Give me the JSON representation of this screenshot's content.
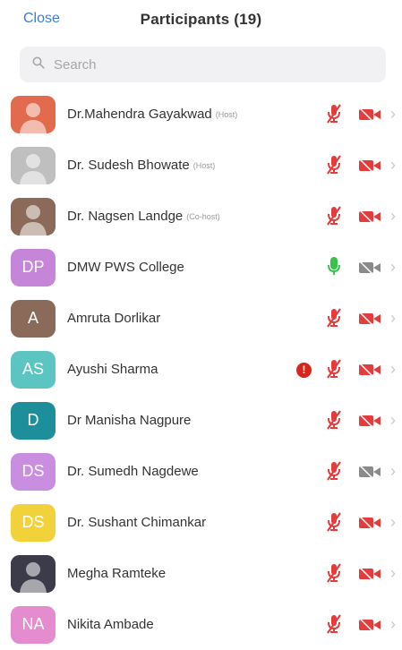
{
  "header": {
    "close_label": "Close",
    "title": "Participants (19)"
  },
  "search": {
    "placeholder": "Search"
  },
  "colors": {
    "accent": "#3a7dd8",
    "muted_red": "#e43b3b",
    "mic_on_green": "#37c24b",
    "video_off_gray": "#8a8a8a",
    "alert_red": "#d9261c"
  },
  "participants": [
    {
      "name": "Dr.Mahendra Gayakwad",
      "role": "(Host)",
      "avatar_type": "photo",
      "initials": "",
      "avatar_color": "#e26b4d",
      "mic": "muted",
      "video": "off-red",
      "alert": false
    },
    {
      "name": "Dr. Sudesh Bhowate",
      "role": "(Host)",
      "avatar_type": "photo",
      "initials": "",
      "avatar_color": "#bfbfbf",
      "mic": "muted",
      "video": "off-red",
      "alert": false
    },
    {
      "name": "Dr. Nagsen Landge",
      "role": "(Co-host)",
      "avatar_type": "photo",
      "initials": "",
      "avatar_color": "#8c6a5a",
      "mic": "muted",
      "video": "off-red",
      "alert": false
    },
    {
      "name": "DMW PWS College",
      "role": "",
      "avatar_type": "initials",
      "initials": "DP",
      "avatar_color": "#c586d9",
      "mic": "on",
      "video": "off-gray",
      "alert": false
    },
    {
      "name": "Amruta Dorlikar",
      "role": "",
      "avatar_type": "initials",
      "initials": "A",
      "avatar_color": "#8a6a58",
      "mic": "muted",
      "video": "off-red",
      "alert": false
    },
    {
      "name": "Ayushi Sharma",
      "role": "",
      "avatar_type": "initials",
      "initials": "AS",
      "avatar_color": "#5cc5c2",
      "mic": "muted",
      "video": "off-red",
      "alert": true
    },
    {
      "name": "Dr Manisha Nagpure",
      "role": "",
      "avatar_type": "initials",
      "initials": "D",
      "avatar_color": "#1c8f9a",
      "mic": "muted",
      "video": "off-red",
      "alert": false
    },
    {
      "name": "Dr. Sumedh Nagdewe",
      "role": "",
      "avatar_type": "initials",
      "initials": "DS",
      "avatar_color": "#c98ee0",
      "mic": "muted",
      "video": "off-gray",
      "alert": false
    },
    {
      "name": "Dr. Sushant Chimankar",
      "role": "",
      "avatar_type": "initials",
      "initials": "DS",
      "avatar_color": "#f2d23b",
      "mic": "muted",
      "video": "off-red",
      "alert": false
    },
    {
      "name": "Megha Ramteke",
      "role": "",
      "avatar_type": "photo",
      "initials": "",
      "avatar_color": "#3b3b4a",
      "mic": "muted",
      "video": "off-red",
      "alert": false
    },
    {
      "name": "Nikita Ambade",
      "role": "",
      "avatar_type": "initials",
      "initials": "NA",
      "avatar_color": "#e58bd0",
      "mic": "muted",
      "video": "off-red",
      "alert": false
    }
  ]
}
